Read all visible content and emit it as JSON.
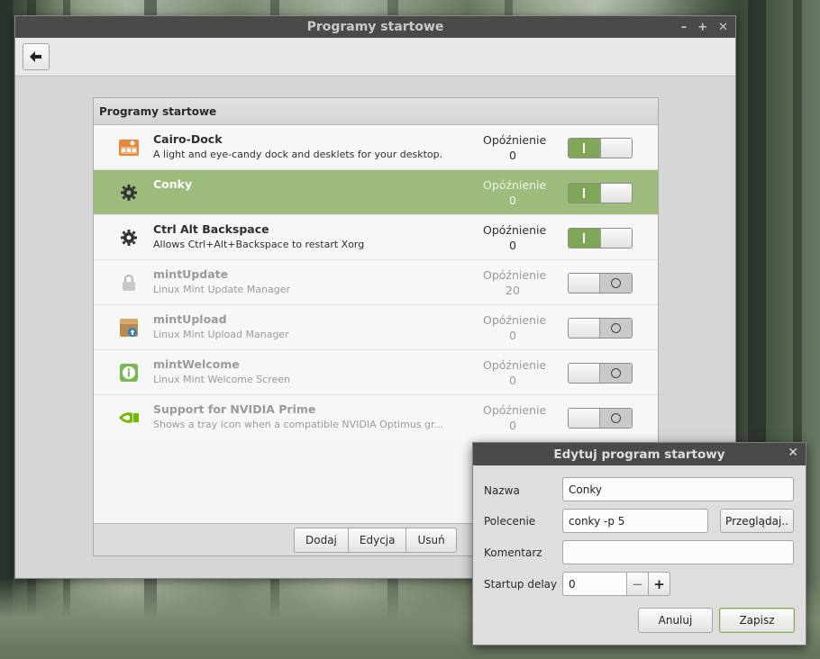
{
  "window": {
    "title": "Programy startowe",
    "controls": {
      "minimize": "–",
      "maximize": "+",
      "close": "✕"
    },
    "back_glyph": "🡸"
  },
  "list": {
    "header": "Programy startowe",
    "rows": [
      {
        "name": "Cairo-Dock",
        "desc": "A light and eye-candy dock and desklets for your desktop.",
        "delay_label": "Opóźnienie",
        "delay": "0",
        "enabled": true,
        "icon": "cairo-dock-icon"
      },
      {
        "name": "Conky",
        "desc": "",
        "delay_label": "Opóźnienie",
        "delay": "0",
        "enabled": true,
        "icon": "gear-icon"
      },
      {
        "name": "Ctrl Alt Backspace",
        "desc": "Allows Ctrl+Alt+Backspace to restart Xorg",
        "delay_label": "Opóźnienie",
        "delay": "0",
        "enabled": true,
        "icon": "gear-icon"
      },
      {
        "name": "mintUpdate",
        "desc": "Linux Mint Update Manager",
        "delay_label": "Opóźnienie",
        "delay": "20",
        "enabled": false,
        "icon": "lock-icon"
      },
      {
        "name": "mintUpload",
        "desc": "Linux Mint Upload Manager",
        "delay_label": "Opóźnienie",
        "delay": "0",
        "enabled": false,
        "icon": "upload-box-icon"
      },
      {
        "name": "mintWelcome",
        "desc": "Linux Mint Welcome Screen",
        "delay_label": "Opóźnienie",
        "delay": "0",
        "enabled": false,
        "icon": "info-icon"
      },
      {
        "name": "Support for NVIDIA Prime",
        "desc": "Shows a tray icon when a compatible NVIDIA Optimus gr...",
        "delay_label": "Opóźnienie",
        "delay": "0",
        "enabled": false,
        "icon": "nvidia-icon"
      }
    ],
    "buttons": {
      "add": "Dodaj",
      "edit": "Edycja",
      "remove": "Usuń"
    }
  },
  "dialog": {
    "title": "Edytuj program startowy",
    "close_glyph": "✕",
    "name_label": "Nazwa",
    "name_value": "Conky",
    "command_label": "Polecenie",
    "command_value": "conky -p 5",
    "browse": "Przeglądaj..",
    "comment_label": "Komentarz",
    "comment_value": "",
    "delay_label": "Startup delay",
    "delay_value": "0",
    "minus": "−",
    "plus": "+",
    "cancel": "Anuluj",
    "save": "Zapisz"
  },
  "colors": {
    "accent": "#9dbc7c",
    "switch_on": "#7fa757",
    "titlebar": "#4a4a4a"
  }
}
